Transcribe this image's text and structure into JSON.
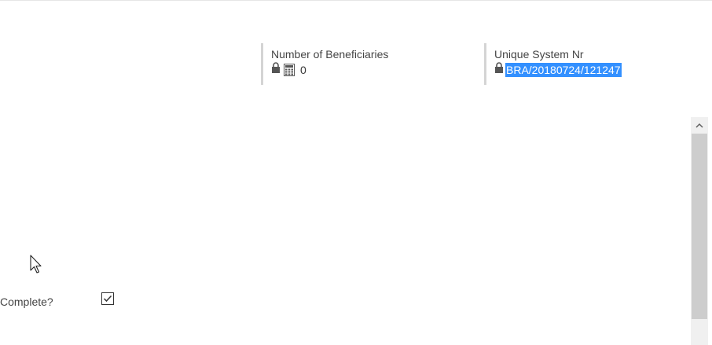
{
  "fields": {
    "beneficiaries": {
      "label": "Number of Beneficiaries",
      "value": "0",
      "icons": [
        "lock-icon",
        "calculator-icon"
      ]
    },
    "unique_system_nr": {
      "label": "Unique System Nr",
      "value": "BRA/20180724/121247",
      "icons": [
        "lock-icon"
      ],
      "selected": true
    }
  },
  "complete": {
    "label": "Complete?",
    "checked": true
  },
  "scrollbar": {
    "up_icon": "chevron-up-icon"
  },
  "colors": {
    "selection": "#3390ff",
    "card_border": "#d4d4d4",
    "scroll_thumb": "#cdcdcd"
  }
}
